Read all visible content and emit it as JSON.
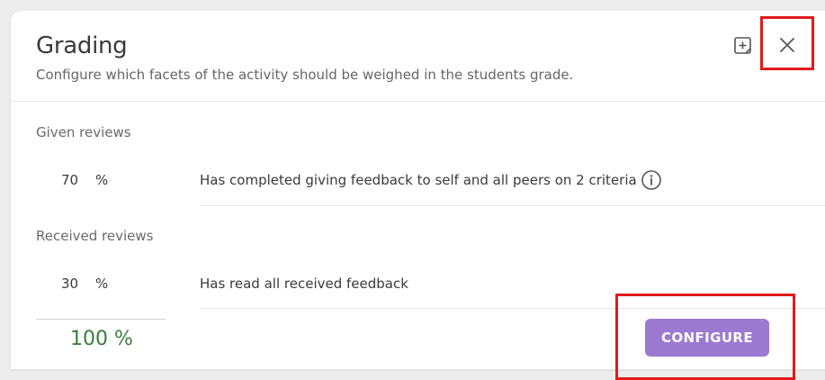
{
  "dialog": {
    "title": "Grading",
    "subtitle": "Configure which facets of the activity should be weighed in the students grade."
  },
  "header_actions": {
    "note_icon": "note-add-icon",
    "close_icon": "close-icon"
  },
  "sections": [
    {
      "label": "Given reviews",
      "percent": "70",
      "percent_unit": "%",
      "description": "Has completed giving feedback to self and all peers on 2 criteria",
      "info_icon": "info-icon"
    },
    {
      "label": "Received reviews",
      "percent": "30",
      "percent_unit": "%",
      "description": "Has read all received feedback"
    }
  ],
  "total": "100 %",
  "configure_button": "CONFIGURE",
  "colors": {
    "accent": "#9c7ad2",
    "total_text": "#3a7d3a",
    "highlight": "#e01b1b"
  }
}
